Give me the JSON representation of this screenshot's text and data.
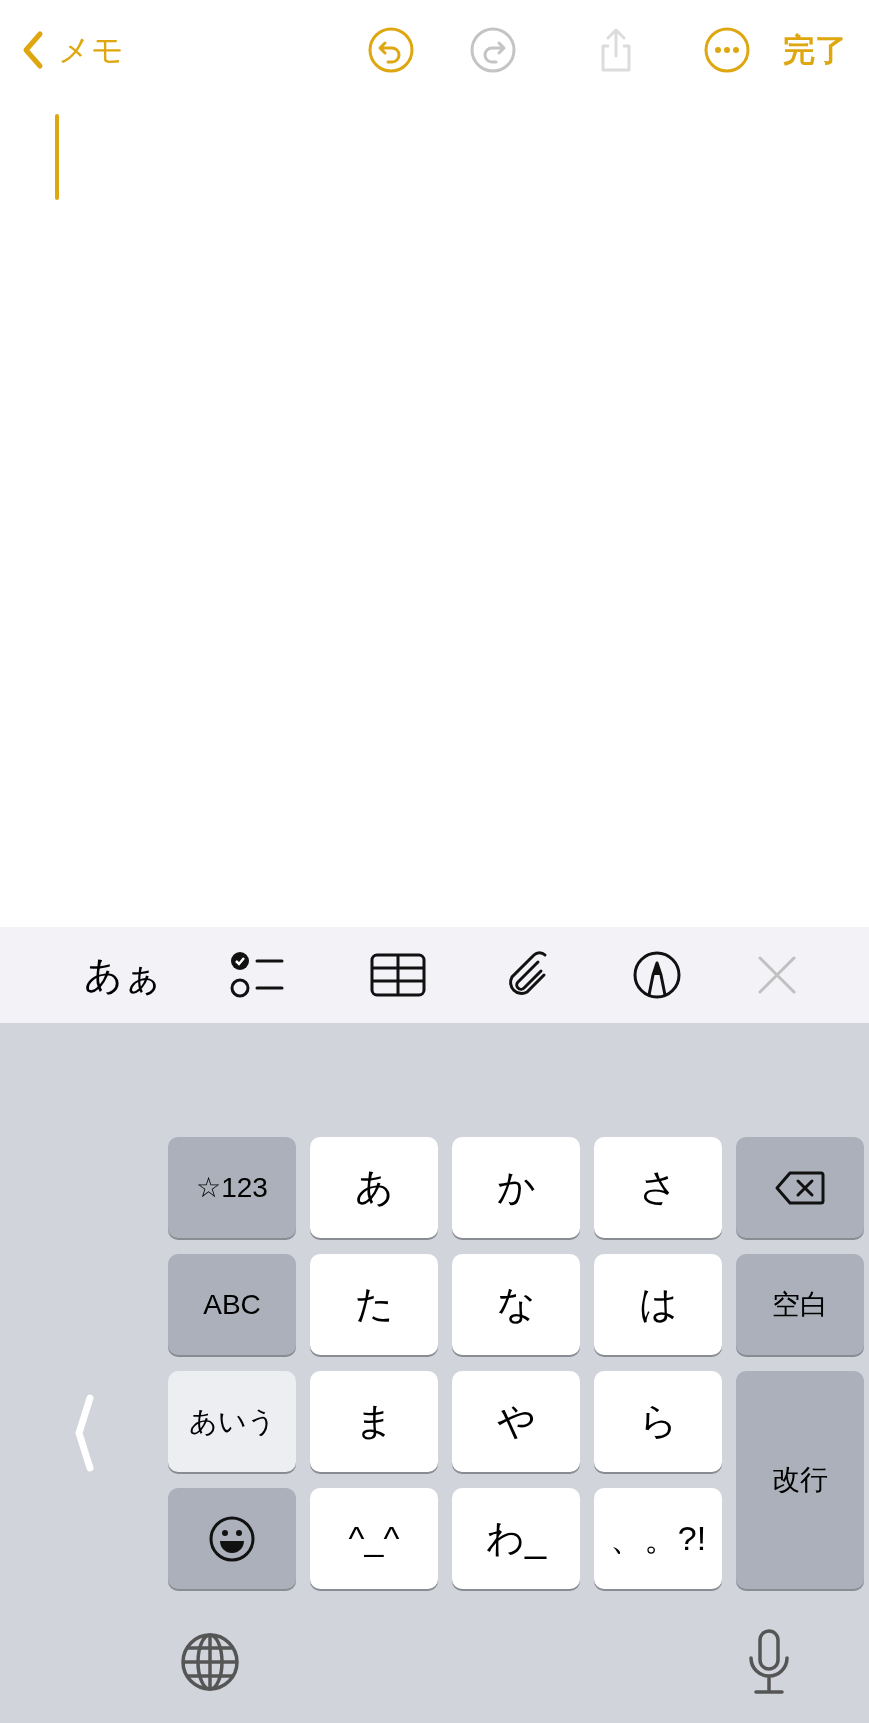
{
  "nav": {
    "back_label": "メモ",
    "done_label": "完了",
    "undo": {
      "disabled": false
    },
    "redo": {
      "disabled": true
    },
    "share": {
      "disabled": true
    }
  },
  "toolbar": {
    "format_label": "あぁ"
  },
  "keyboard": {
    "keys": [
      {
        "kind": "mode",
        "label": "☆123",
        "selected": false
      },
      {
        "kind": "letter",
        "label": "あ"
      },
      {
        "kind": "letter",
        "label": "か"
      },
      {
        "kind": "letter",
        "label": "さ"
      },
      {
        "kind": "delete"
      },
      {
        "kind": "mode",
        "label": "ABC",
        "selected": false
      },
      {
        "kind": "letter",
        "label": "た"
      },
      {
        "kind": "letter",
        "label": "な"
      },
      {
        "kind": "letter",
        "label": "は"
      },
      {
        "kind": "function",
        "label": "空白"
      },
      {
        "kind": "mode",
        "label": "あいう",
        "selected": true
      },
      {
        "kind": "letter",
        "label": "ま"
      },
      {
        "kind": "letter",
        "label": "や"
      },
      {
        "kind": "letter",
        "label": "ら"
      },
      {
        "kind": "return",
        "label": "改行"
      },
      {
        "kind": "emoji"
      },
      {
        "kind": "letter",
        "label": "^_^"
      },
      {
        "kind": "letter",
        "label": "わ_"
      },
      {
        "kind": "letter",
        "label": "、。?!"
      }
    ]
  }
}
